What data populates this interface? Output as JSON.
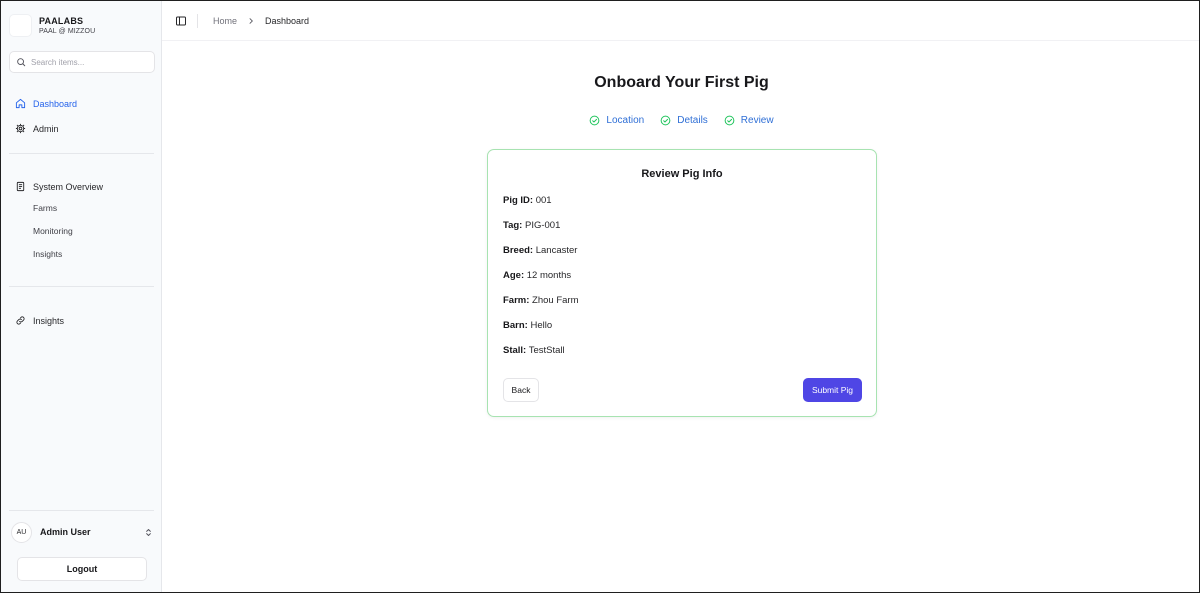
{
  "brand": {
    "name": "PAALABS",
    "subtitle": "PAAL @ MIZZOU"
  },
  "search": {
    "placeholder": "Search items..."
  },
  "sidebar": {
    "nav": [
      {
        "label": "Dashboard",
        "icon": "home-icon",
        "active": true
      },
      {
        "label": "Admin",
        "icon": "gear-icon",
        "active": false
      }
    ],
    "section": {
      "label": "System Overview",
      "icon": "document-icon",
      "items": [
        "Farms",
        "Monitoring",
        "Insights"
      ]
    },
    "extra": {
      "label": "Insights",
      "icon": "link-icon"
    }
  },
  "user": {
    "initials": "AU",
    "name": "Admin User"
  },
  "logout_label": "Logout",
  "breadcrumb": {
    "home": "Home",
    "current": "Dashboard"
  },
  "page": {
    "title": "Onboard Your First Pig",
    "steps": [
      "Location",
      "Details",
      "Review"
    ]
  },
  "card": {
    "title": "Review Pig Info",
    "fields": [
      {
        "label": "Pig ID:",
        "value": "001"
      },
      {
        "label": "Tag:",
        "value": "PIG-001"
      },
      {
        "label": "Breed:",
        "value": "Lancaster"
      },
      {
        "label": "Age:",
        "value": "12 months"
      },
      {
        "label": "Farm:",
        "value": "Zhou Farm"
      },
      {
        "label": "Barn:",
        "value": "Hello"
      },
      {
        "label": "Stall:",
        "value": "TestStall"
      }
    ],
    "back_label": "Back",
    "submit_label": "Submit Pig"
  },
  "colors": {
    "accent": "#4f46e5",
    "active_nav": "#2563eb",
    "step_complete": "#22c55e",
    "card_border": "#a7e3b1"
  }
}
